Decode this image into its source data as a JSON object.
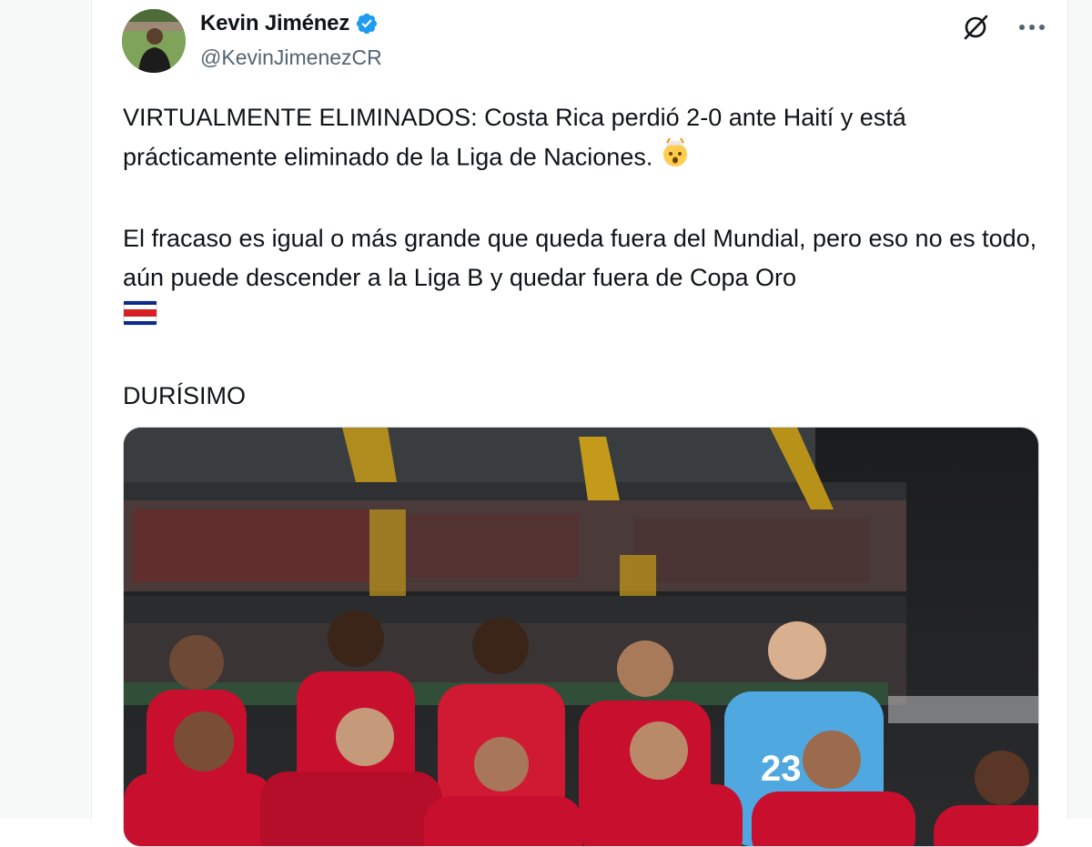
{
  "author": {
    "display_name": "Kevin Jiménez",
    "handle": "@KevinJimenezCR",
    "verified": true
  },
  "icons": {
    "verified": "verified-badge-icon",
    "grok": "grok-icon",
    "more": "more-options-icon",
    "emoji_1": "exploding-head-emoji",
    "emoji_2": "costa-rica-flag-emoji"
  },
  "tweet": {
    "paragraph_1": "VIRTUALMENTE ELIMINADOS: Costa Rica perdió 2-0 ante Haití y está prácticamente eliminado de la Liga de Naciones.",
    "paragraph_2": "El fracaso es igual o más grande que queda fuera del Mundial, pero eso no es todo, aún puede descender a la Liga B y quedar fuera de Copa Oro",
    "paragraph_3": "DURÍSIMO"
  },
  "media": {
    "goalkeeper_number": "23"
  },
  "colors": {
    "verified_blue": "#1d9bf0",
    "text": "#0f1419",
    "secondary_text": "#536471",
    "jersey_red": "#c8102e",
    "goalkeeper_blue": "#4fa8e0"
  }
}
